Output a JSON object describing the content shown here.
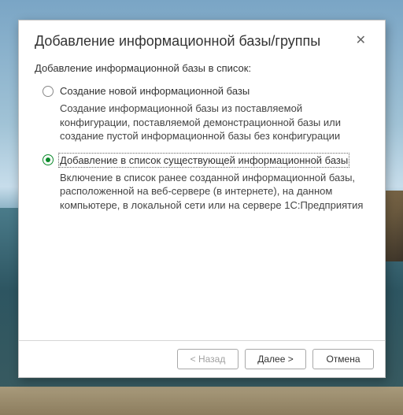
{
  "dialog": {
    "title": "Добавление информационной базы/группы",
    "prompt": "Добавление информационной базы в список:",
    "options": [
      {
        "label": "Создание новой информационной базы",
        "description": "Создание информационной базы из поставляемой конфигурации, поставляемой демонстрационной базы или создание пустой информационной базы без конфигурации",
        "selected": false
      },
      {
        "label": "Добавление в список существующей информационной базы",
        "description": "Включение в список ранее созданной информационной базы, расположенной на веб-сервере (в интернете), на данном компьютере,  в локальной сети или на сервере 1С:Предприятия",
        "selected": true
      }
    ],
    "buttons": {
      "back": "< Назад",
      "next": "Далее >",
      "cancel": "Отмена"
    }
  }
}
